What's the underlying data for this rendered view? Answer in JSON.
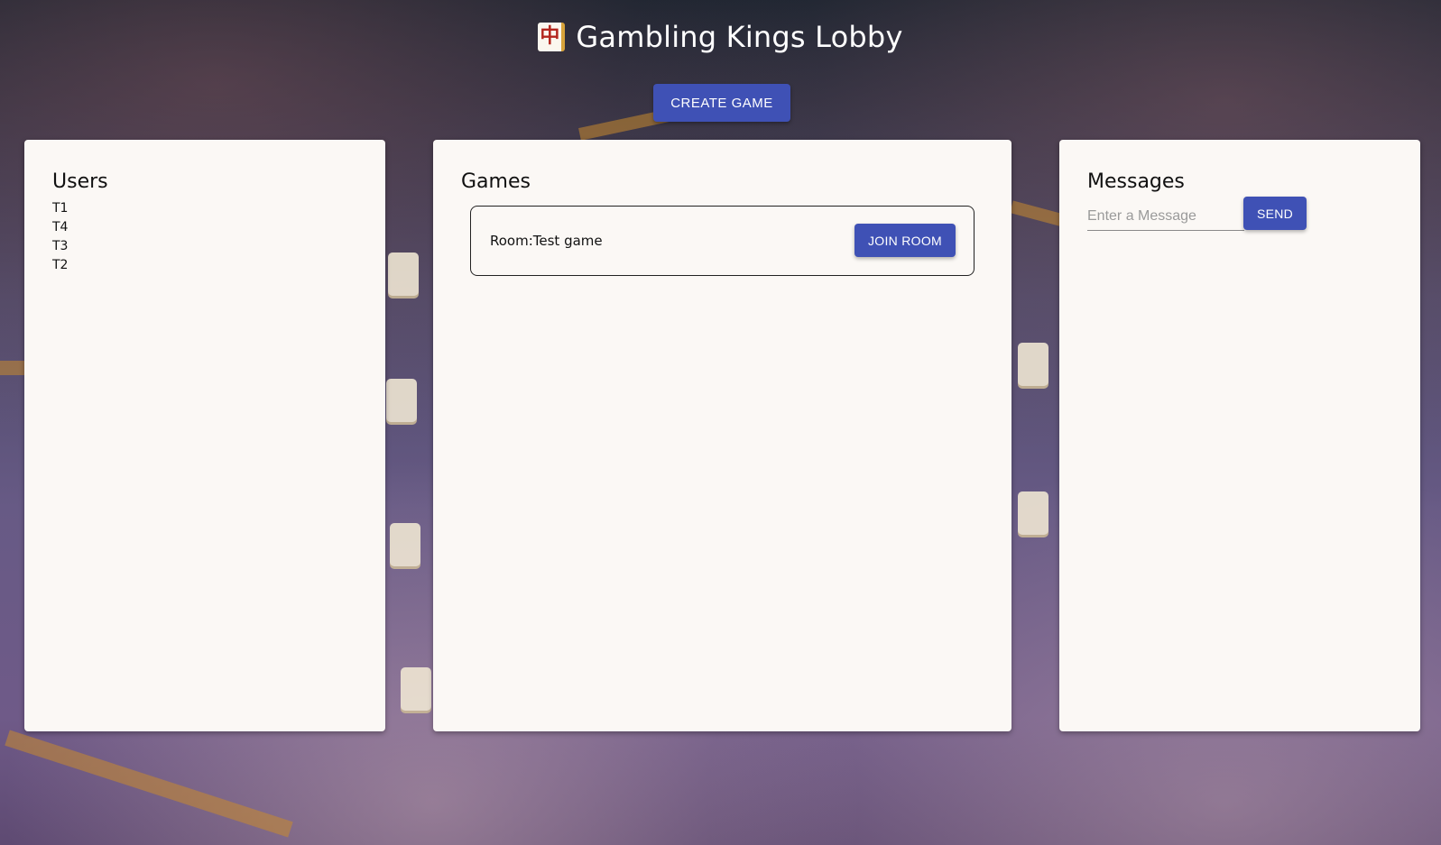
{
  "header": {
    "icon": "mahjong-tile-icon",
    "icon_glyph": "中",
    "title": "Gambling Kings Lobby",
    "create_button_label": "CREATE GAME"
  },
  "users": {
    "title": "Users",
    "items": [
      "T1",
      "T4",
      "T3",
      "T2"
    ]
  },
  "games": {
    "title": "Games",
    "rooms": [
      {
        "label": "Room:Test game",
        "join_label": "JOIN ROOM"
      }
    ]
  },
  "messages": {
    "title": "Messages",
    "input_placeholder": "Enter a Message",
    "input_value": "",
    "send_label": "SEND"
  },
  "colors": {
    "primary": "#3f51b5",
    "panel_bg": "#fbf8f5",
    "title_text": "#ffffff"
  }
}
